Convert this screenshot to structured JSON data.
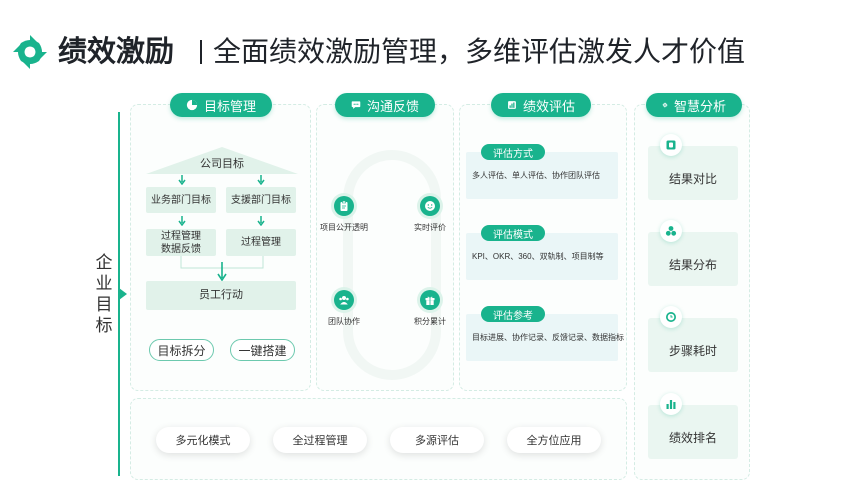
{
  "header": {
    "brand": "绩效激励",
    "slogan": "全面绩效激励管理，多维评估激发人才价值"
  },
  "side_label": "企业目标",
  "colors": {
    "accent": "#19b38d",
    "box_fill": "#e1f2ea",
    "tag_fill": "#eaf6f7"
  },
  "panels": {
    "goal": {
      "title": "目标管理",
      "icon": "pie-icon",
      "roof": "公司目标",
      "dept_business": "业务部门目标",
      "dept_support": "支援部门目标",
      "process_mgmt_data": [
        "过程管理",
        "数据反馈"
      ],
      "process_mgmt": "过程管理",
      "employee_action": "员工行动",
      "buttons": [
        "目标拆分",
        "一键搭建"
      ]
    },
    "feedback": {
      "title": "沟通反馈",
      "icon": "chat-icon",
      "nodes": [
        {
          "label": "项目公开透明",
          "icon": "clipboard-icon"
        },
        {
          "label": "实时评价",
          "icon": "smile-icon"
        },
        {
          "label": "团队协作",
          "icon": "team-icon"
        },
        {
          "label": "积分累计",
          "icon": "gift-icon"
        }
      ]
    },
    "evaluation": {
      "title": "绩效评估",
      "icon": "chart-icon",
      "sections": [
        {
          "tag": "评估方式",
          "text": "多人评估、单人评估、协作团队评估"
        },
        {
          "tag": "评估模式",
          "text": "KPI、OKR、360、双轨制、项目制等"
        },
        {
          "tag": "评估参考",
          "text": "目标进展、协作记录、反馈记录、数据指标"
        }
      ]
    },
    "analysis": {
      "title": "智慧分析",
      "icon": "gear-icon",
      "cards": [
        {
          "label": "结果对比",
          "icon": "compare-icon"
        },
        {
          "label": "结果分布",
          "icon": "distribution-icon"
        },
        {
          "label": "步骤耗时",
          "icon": "clock-icon"
        },
        {
          "label": "绩效排名",
          "icon": "ranking-icon"
        }
      ]
    }
  },
  "bottom": [
    "多元化模式",
    "全过程管理",
    "多源评估",
    "全方位应用"
  ]
}
